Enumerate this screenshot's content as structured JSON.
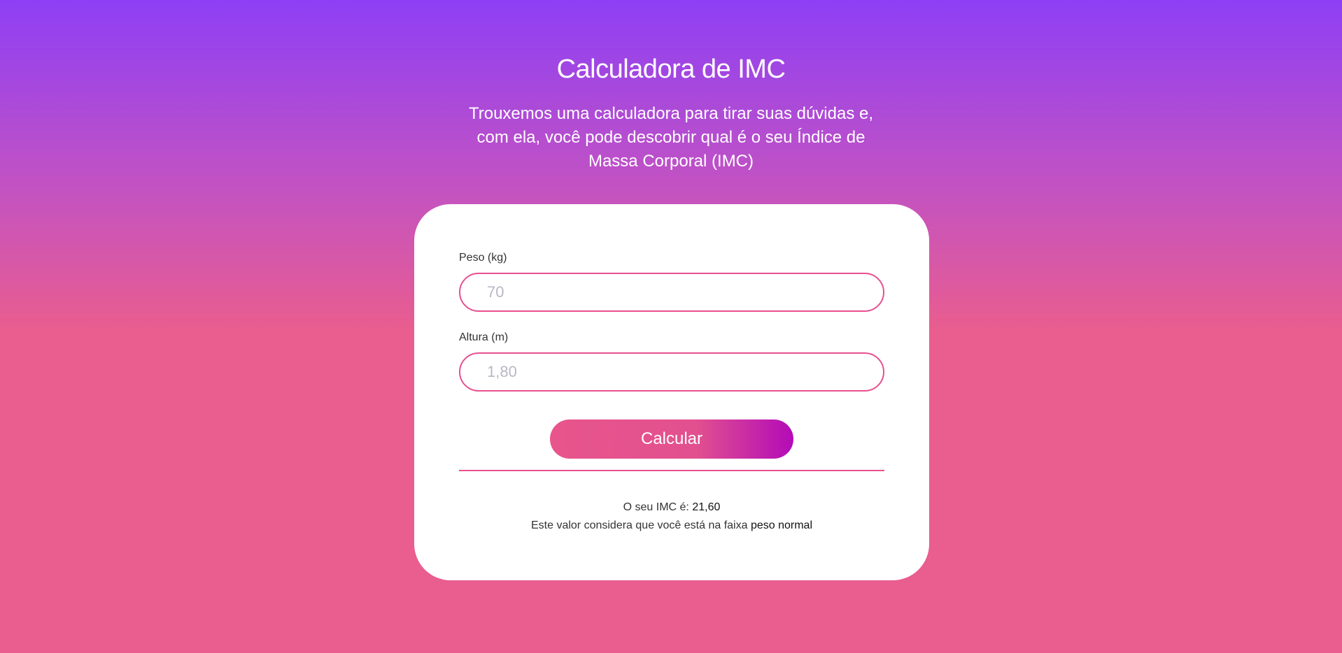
{
  "header": {
    "title": "Calculadora de IMC",
    "subtitle": "Trouxemos uma calculadora para tirar suas dúvidas e, com ela, você pode descobrir qual é o seu Índice de Massa Corporal (IMC)"
  },
  "form": {
    "weight": {
      "label": "Peso (kg)",
      "placeholder": "70",
      "value": ""
    },
    "height": {
      "label": "Altura (m)",
      "placeholder": "1,80",
      "value": ""
    },
    "submit_label": "Calcular"
  },
  "result": {
    "imc_prefix": "O seu IMC é:",
    "imc_value": "21,60",
    "range_prefix": "Este valor considera que você está na faixa",
    "range_value": "peso normal"
  },
  "colors": {
    "background_top": "#8e3ff5",
    "background_bottom": "#e95d8f",
    "accent": "#e8508f",
    "button_end": "#b30bb8"
  }
}
